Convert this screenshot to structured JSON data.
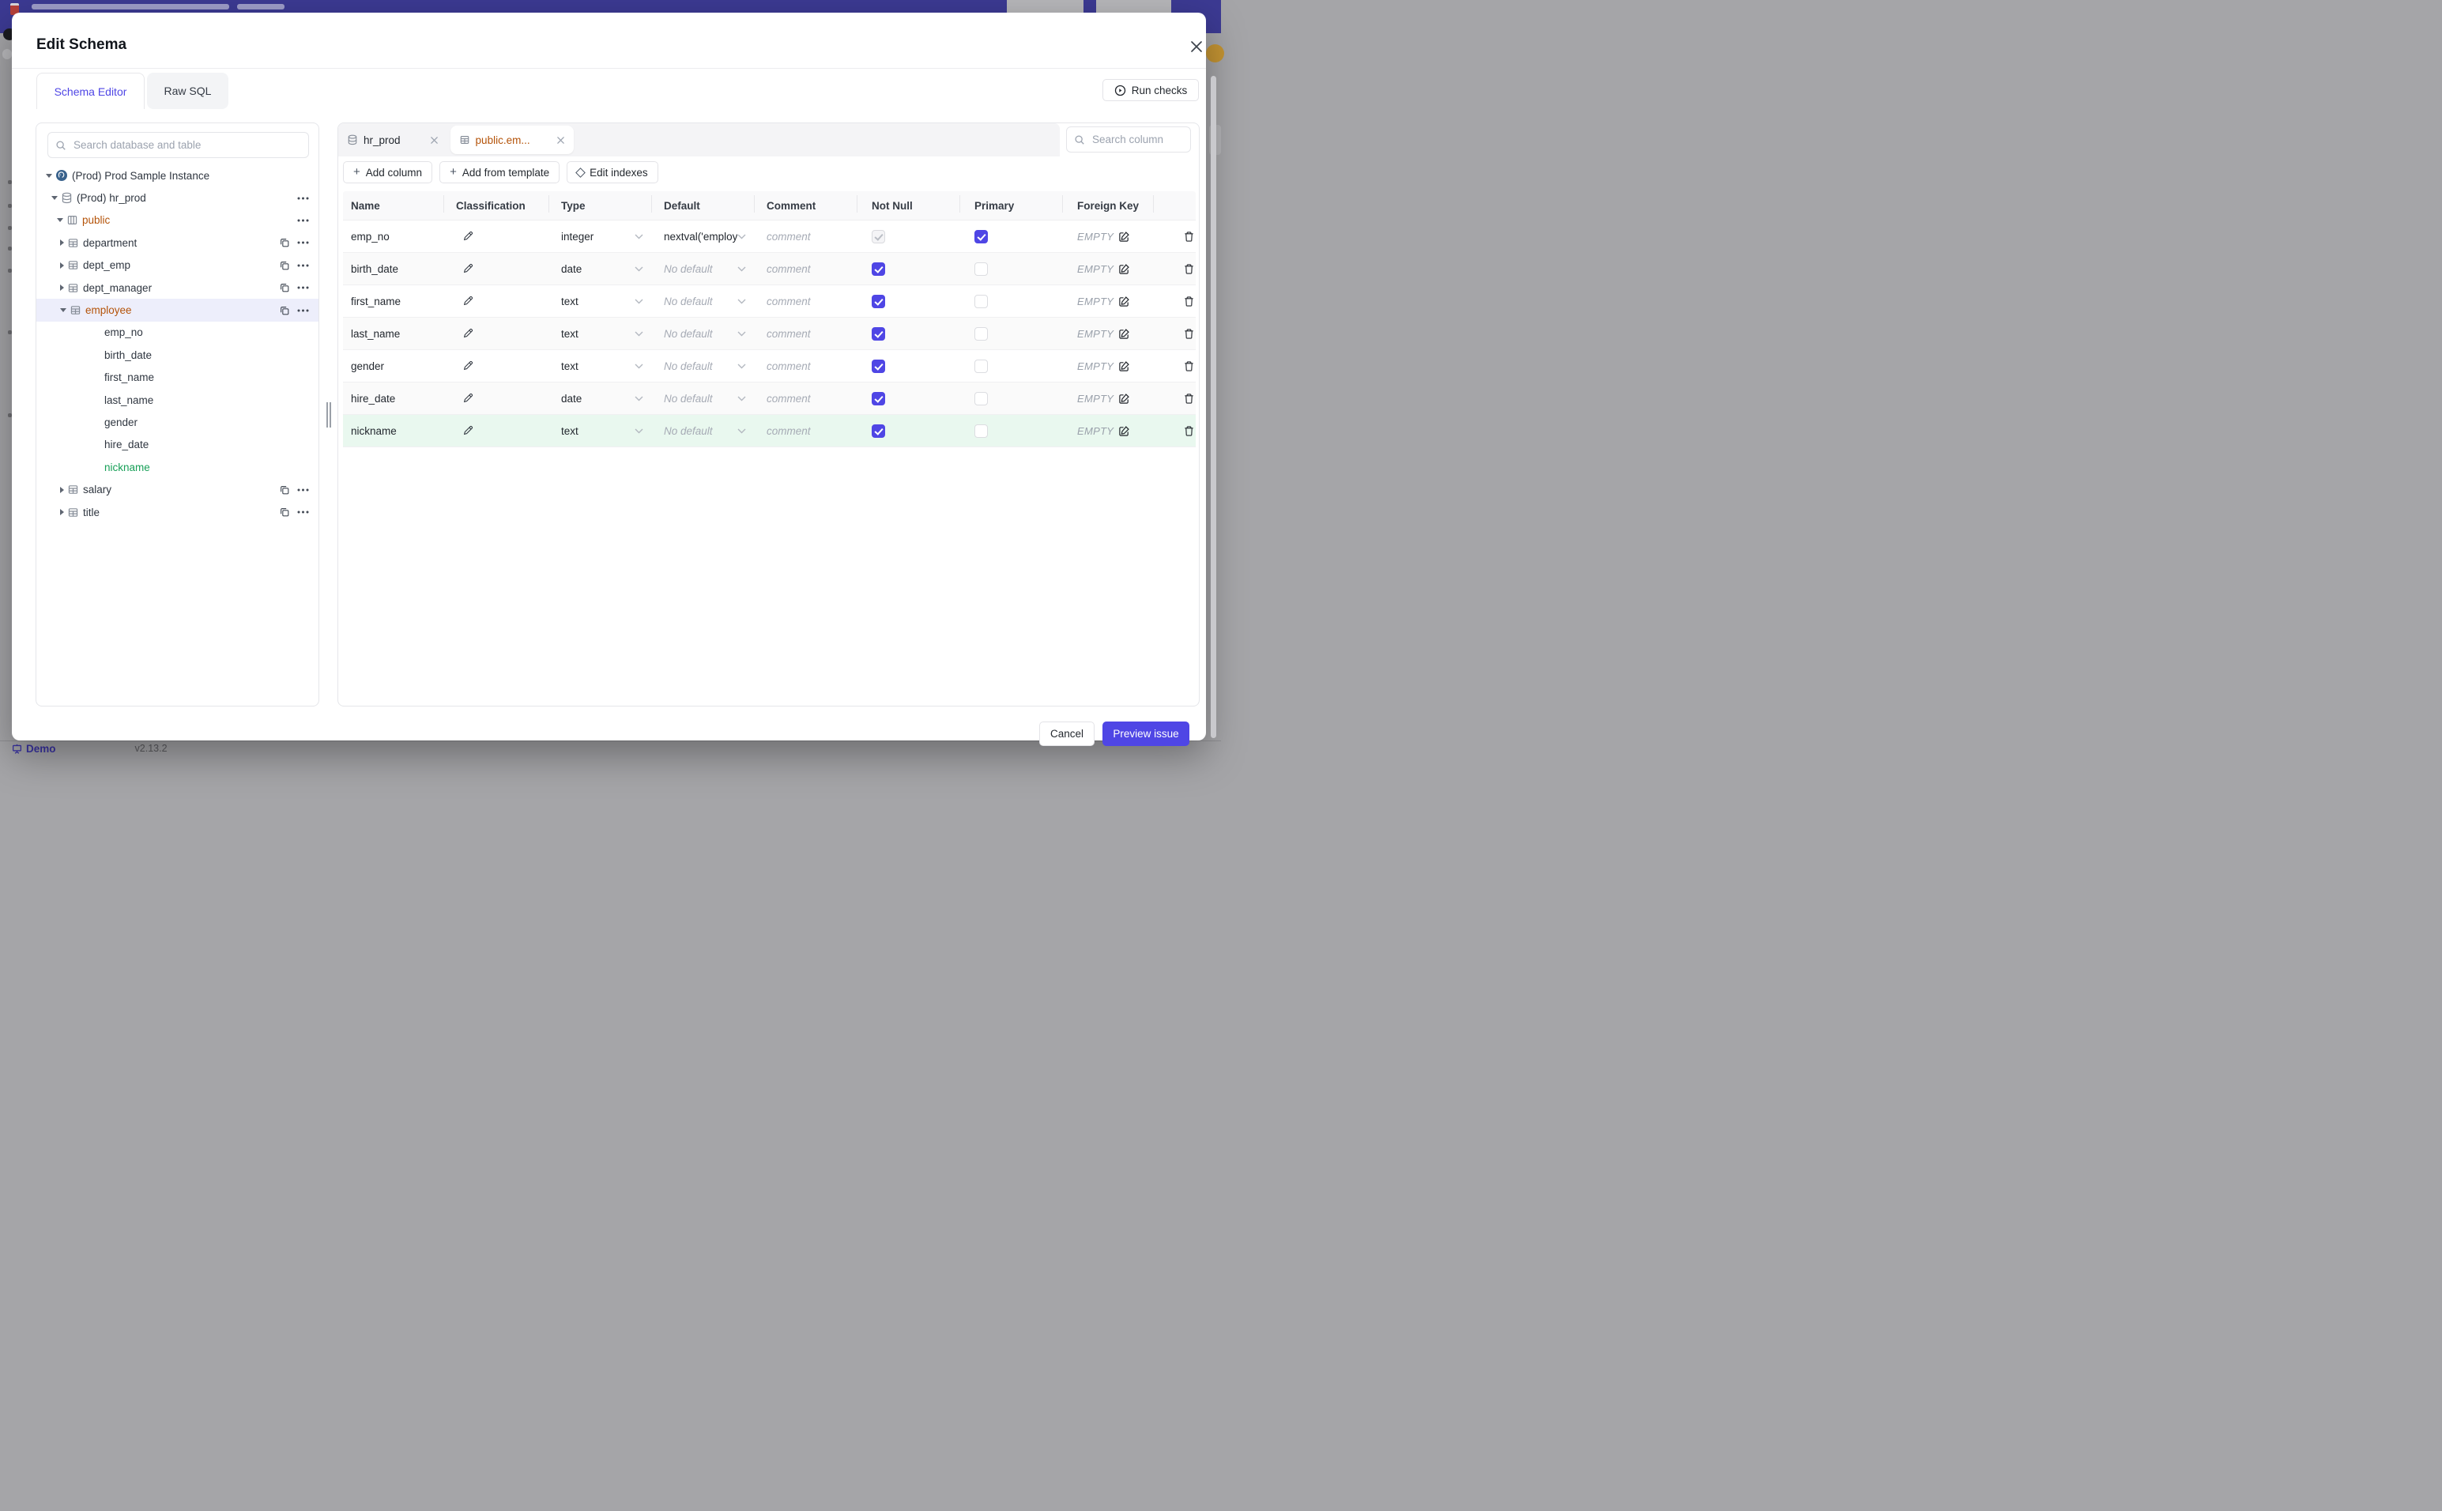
{
  "backdrop": {
    "demo": "Demo",
    "version": "v2.13.2"
  },
  "modal": {
    "title": "Edit Schema",
    "tabs": [
      {
        "label": "Schema Editor",
        "active": true
      },
      {
        "label": "Raw SQL",
        "active": false
      }
    ],
    "run_checks": "Run checks",
    "cancel": "Cancel",
    "preview_issue": "Preview issue"
  },
  "sidebar": {
    "search_placeholder": "Search database and table",
    "tree": [
      {
        "label": "(Prod) Prod Sample Instance",
        "type": "instance",
        "expanded": true
      },
      {
        "label": "(Prod) hr_prod",
        "type": "database",
        "expanded": true
      },
      {
        "label": "public",
        "type": "schema",
        "expanded": true
      },
      {
        "label": "department",
        "type": "table",
        "expanded": false
      },
      {
        "label": "dept_emp",
        "type": "table",
        "expanded": false
      },
      {
        "label": "dept_manager",
        "type": "table",
        "expanded": false
      },
      {
        "label": "employee",
        "type": "table",
        "expanded": true,
        "selected": true
      },
      {
        "label": "emp_no",
        "type": "column"
      },
      {
        "label": "birth_date",
        "type": "column"
      },
      {
        "label": "first_name",
        "type": "column"
      },
      {
        "label": "last_name",
        "type": "column"
      },
      {
        "label": "gender",
        "type": "column"
      },
      {
        "label": "hire_date",
        "type": "column"
      },
      {
        "label": "nickname",
        "type": "column",
        "added": true
      },
      {
        "label": "salary",
        "type": "table",
        "expanded": false
      },
      {
        "label": "title",
        "type": "table",
        "expanded": false
      }
    ]
  },
  "editor": {
    "chips": [
      {
        "label": "hr_prod",
        "icon": "database"
      },
      {
        "label": "public.em...",
        "icon": "table",
        "active": true
      }
    ],
    "search_placeholder": "Search column",
    "toolbar": [
      {
        "label": "Add column"
      },
      {
        "label": "Add from template"
      },
      {
        "label": "Edit indexes"
      }
    ],
    "table": {
      "headers": [
        "Name",
        "Classification",
        "Type",
        "Default",
        "Comment",
        "Not Null",
        "Primary",
        "Foreign Key"
      ],
      "rows": [
        {
          "name": "emp_no",
          "type": "integer",
          "default": "nextval('employ",
          "default_is_placeholder": false,
          "comment": "comment",
          "not_null": true,
          "not_null_disabled": true,
          "primary": true,
          "foreign_key": "EMPTY"
        },
        {
          "name": "birth_date",
          "type": "date",
          "default": "No default",
          "default_is_placeholder": true,
          "comment": "comment",
          "not_null": true,
          "primary": false,
          "foreign_key": "EMPTY"
        },
        {
          "name": "first_name",
          "type": "text",
          "default": "No default",
          "default_is_placeholder": true,
          "comment": "comment",
          "not_null": true,
          "primary": false,
          "foreign_key": "EMPTY"
        },
        {
          "name": "last_name",
          "type": "text",
          "default": "No default",
          "default_is_placeholder": true,
          "comment": "comment",
          "not_null": true,
          "primary": false,
          "foreign_key": "EMPTY"
        },
        {
          "name": "gender",
          "type": "text",
          "default": "No default",
          "default_is_placeholder": true,
          "comment": "comment",
          "not_null": true,
          "primary": false,
          "foreign_key": "EMPTY"
        },
        {
          "name": "hire_date",
          "type": "date",
          "default": "No default",
          "default_is_placeholder": true,
          "comment": "comment",
          "not_null": true,
          "primary": false,
          "foreign_key": "EMPTY"
        },
        {
          "name": "nickname",
          "type": "text",
          "default": "No default",
          "default_is_placeholder": true,
          "comment": "comment",
          "not_null": true,
          "primary": false,
          "foreign_key": "EMPTY",
          "added": true
        }
      ]
    }
  },
  "colors": {
    "accent": "#4f46e5",
    "selected_table": "#b45309",
    "added_green": "#18a058",
    "added_row_bg": "#e9f8ef"
  }
}
